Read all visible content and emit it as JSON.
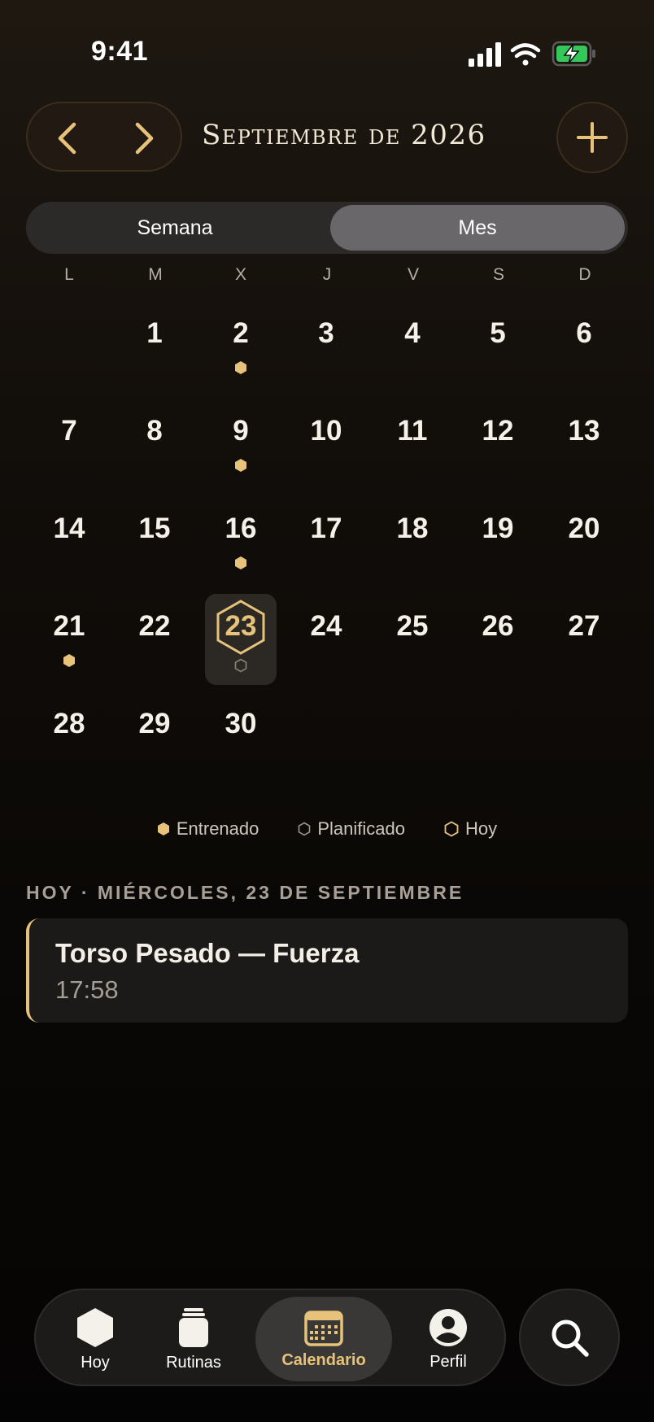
{
  "status": {
    "time": "9:41"
  },
  "header": {
    "title": "Septiembre de 2026"
  },
  "segment": {
    "week": "Semana",
    "month": "Mes",
    "selected": "Mes"
  },
  "weekdays": [
    "L",
    "M",
    "X",
    "J",
    "V",
    "S",
    "D"
  ],
  "calendar": {
    "weeks": [
      [
        "",
        "1",
        "2",
        "3",
        "4",
        "5",
        "6"
      ],
      [
        "7",
        "8",
        "9",
        "10",
        "11",
        "12",
        "13"
      ],
      [
        "14",
        "15",
        "16",
        "17",
        "18",
        "19",
        "20"
      ],
      [
        "21",
        "22",
        "23",
        "24",
        "25",
        "26",
        "27"
      ],
      [
        "28",
        "29",
        "30",
        "",
        "",
        "",
        ""
      ]
    ],
    "trained_days": [
      "2",
      "9",
      "16",
      "21"
    ],
    "planned_days": [
      "23"
    ],
    "today": "23"
  },
  "legend": {
    "trained": "Entrenado",
    "planned": "Planificado",
    "today": "Hoy"
  },
  "section": {
    "title": "HOY · MIÉRCOLES, 23 DE SEPTIEMBRE"
  },
  "card": {
    "title": "Torso Pesado — Fuerza",
    "time": "17:58"
  },
  "tabs": [
    {
      "label": "Hoy",
      "icon": "hexagon-icon"
    },
    {
      "label": "Rutinas",
      "icon": "jar-icon"
    },
    {
      "label": "Calendario",
      "icon": "calendar-icon"
    },
    {
      "label": "Perfil",
      "icon": "profile-icon"
    }
  ],
  "colors": {
    "accent": "#e6c27a",
    "card": "#1b1a19",
    "segment_active": "#69676a"
  }
}
